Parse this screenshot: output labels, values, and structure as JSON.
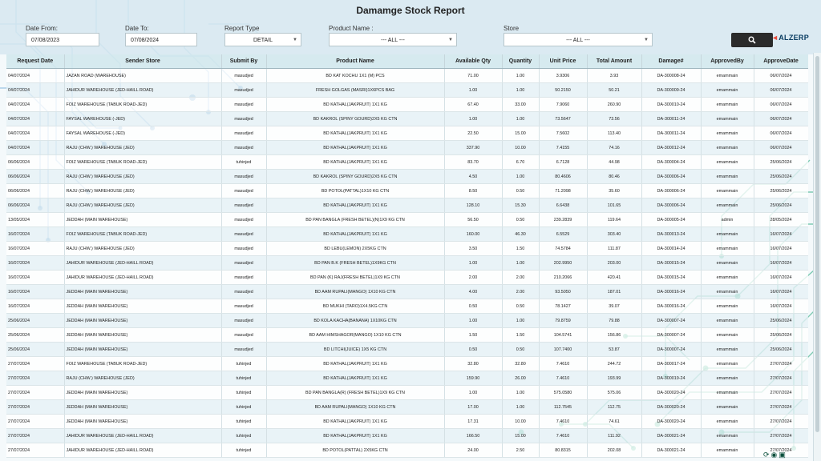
{
  "report": {
    "title": "Damamge Stock Report"
  },
  "filters": {
    "date_from_label": "Date From:",
    "date_from_value": "07/08/2023",
    "date_to_label": "Date To:",
    "date_to_value": "07/08/2024",
    "report_type_label": "Report Type",
    "report_type_value": "DETAIL",
    "product_label": "Product Name :",
    "product_value": "--- ALL ---",
    "store_label": "Store",
    "store_value": "--- ALL ---"
  },
  "logo": {
    "prefix": "◄",
    "text": "ALZERP"
  },
  "table": {
    "headers": [
      "Request Date",
      "Sender Store",
      "Submit By",
      "Product Name",
      "Available Qty",
      "Quantity",
      "Unit Price",
      "Total Amount",
      "Damage#",
      "ApprovedBy",
      "ApproveDate"
    ],
    "rows": [
      [
        "04/07/2024",
        "JAZAN ROAD (WAREHOUSE)",
        "masudjed",
        "BD KAT KOCHU 1X1 (M) PCS",
        "71.00",
        "1.00",
        "3.9306",
        "3.93",
        "DA-300008-24",
        "emammain",
        "06/07/2024"
      ],
      [
        "04/07/2024",
        "JAHIDUR WAREHOUSE (JED-HAILL ROAD)",
        "masudjed",
        "FRESH GOLGAS (MASRI)1X6PCS BAG",
        "1.00",
        "1.00",
        "50.2150",
        "50.21",
        "DA-300009-24",
        "emammain",
        "06/07/2024"
      ],
      [
        "04/07/2024",
        "FOIZ WAREHOUSE (TABUK ROAD-JED)",
        "masudjed",
        "BD KATHAL(JAKPRUIT) 1X1 KG",
        "67.40",
        "33.00",
        "7.9060",
        "260.90",
        "DA-300010-24",
        "emammain",
        "06/07/2024"
      ],
      [
        "04/07/2024",
        "FAYSAL WAREHOUSE (-JED)",
        "masudjed",
        "BD KAKROL (SPINY GOURD)2X5 KG CTN",
        "1.00",
        "1.00",
        "73.5647",
        "73.56",
        "DA-300011-24",
        "emammain",
        "06/07/2024"
      ],
      [
        "04/07/2024",
        "FAYSAL WAREHOUSE (-JED)",
        "masudjed",
        "BD KATHAL(JAKPRUIT) 1X1 KG",
        "22.50",
        "15.00",
        "7.5602",
        "113.40",
        "DA-300011-24",
        "emammain",
        "06/07/2024"
      ],
      [
        "04/07/2024",
        "RAJU (CHW.) WAREHOUSE (JED)",
        "masudjed",
        "BD KATHAL(JAKPRUIT) 1X1 KG",
        "337.90",
        "10.00",
        "7.4155",
        "74.16",
        "DA-300012-24",
        "emammain",
        "06/07/2024"
      ],
      [
        "06/06/2024",
        "FOIZ WAREHOUSE (TABUK ROAD-JED)",
        "tuhinjed",
        "BD KATHAL(JAKPRUIT) 1X1 KG",
        "83.70",
        "6.70",
        "6.7128",
        "44.98",
        "DA-300004-24",
        "emammain",
        "25/06/2024"
      ],
      [
        "06/06/2024",
        "RAJU (CHW.) WAREHOUSE (JED)",
        "masudjed",
        "BD KAKROL (SPINY GOURD)2X5 KG CTN",
        "4.50",
        "1.00",
        "80.4606",
        "80.46",
        "DA-300006-24",
        "emammain",
        "25/06/2024"
      ],
      [
        "06/06/2024",
        "RAJU (CHW.) WAREHOUSE (JED)",
        "masudjed",
        "BD POTOL(PATTAL)1X10 KG CTN",
        "8.50",
        "0.50",
        "71.2098",
        "35.60",
        "DA-300006-24",
        "emammain",
        "25/06/2024"
      ],
      [
        "06/06/2024",
        "RAJU (CHW.) WAREHOUSE (JED)",
        "masudjed",
        "BD KATHAL(JAKPRUIT) 1X1 KG",
        "128.10",
        "15.30",
        "6.6438",
        "101.65",
        "DA-300006-24",
        "emammain",
        "25/06/2024"
      ],
      [
        "13/05/2024",
        "JEDDAH (MAIN WAREHOUSE)",
        "masudjed",
        "BD PAN BANGLA (FRESH BETEL)(N)1X9 KG CTN",
        "56.50",
        "0.50",
        "239.2839",
        "119.64",
        "DA-300005-24",
        "admin",
        "28/05/2024"
      ],
      [
        "16/07/2024",
        "FOIZ WAREHOUSE (TABUK ROAD-JED)",
        "masudjed",
        "BD KATHAL(JAKPRUIT) 1X1 KG",
        "160.00",
        "46.30",
        "6.5529",
        "303.40",
        "DA-300013-24",
        "emammain",
        "16/07/2024"
      ],
      [
        "16/07/2024",
        "RAJU (CHW.) WAREHOUSE (JED)",
        "masudjed",
        "BD LEBU(LEMON) 2X5KG CTN",
        "3.50",
        "1.50",
        "74.5784",
        "111.87",
        "DA-300014-24",
        "emammain",
        "16/07/2024"
      ],
      [
        "16/07/2024",
        "JAHIDUR WAREHOUSE (JED-HAILL ROAD)",
        "masudjed",
        "BD PAN B.K (FRESH BETEL)1X9KG CTN",
        "1.00",
        "1.00",
        "202.9950",
        "203.00",
        "DA-300015-24",
        "emammain",
        "16/07/2024"
      ],
      [
        "16/07/2024",
        "JAHIDUR WAREHOUSE (JED-HAILL ROAD)",
        "masudjed",
        "BD PAN (K) RAJ(FRESH BETEL)1X9 KG CTN",
        "2.00",
        "2.00",
        "210.2066",
        "420.41",
        "DA-300015-24",
        "emammain",
        "16/07/2024"
      ],
      [
        "16/07/2024",
        "JEDDAH (MAIN WAREHOUSE)",
        "masudjed",
        "BD AAM RUPALI(MANGO) 1X10 KG CTN",
        "4.00",
        "2.00",
        "93.5050",
        "187.01",
        "DA-300016-24",
        "emammain",
        "16/07/2024"
      ],
      [
        "16/07/2024",
        "JEDDAH (MAIN WAREHOUSE)",
        "masudjed",
        "BD MUKHI (TARO)1X4.5KG CTN",
        "0.50",
        "0.50",
        "78.1427",
        "39.07",
        "DA-300016-24",
        "emammain",
        "16/07/2024"
      ],
      [
        "25/06/2024",
        "JEDDAH (MAIN WAREHOUSE)",
        "masudjed",
        "BD KOLA KACHA(BANANA) 1X10KG CTN",
        "1.00",
        "1.00",
        "79.8759",
        "79.88",
        "DA-300007-24",
        "emammain",
        "25/06/2024"
      ],
      [
        "25/06/2024",
        "JEDDAH (MAIN WAREHOUSE)",
        "masudjed",
        "BD AAM HIMSHAGOR(MANGO) 1X10 KG CTN",
        "1.50",
        "1.50",
        "104.5741",
        "156.86",
        "DA-300007-24",
        "emammain",
        "25/06/2024"
      ],
      [
        "25/06/2024",
        "JEDDAH (MAIN WAREHOUSE)",
        "masudjed",
        "BD LITCHI(JUICE) 1X5 KG CTN",
        "0.50",
        "0.50",
        "107.7400",
        "53.87",
        "DA-300007-24",
        "emammain",
        "25/06/2024"
      ],
      [
        "27/07/2024",
        "FOIZ WAREHOUSE (TABUK ROAD-JED)",
        "tuhinjed",
        "BD KATHAL(JAKPRUIT) 1X1 KG",
        "32.80",
        "32.80",
        "7.4610",
        "244.72",
        "DA-300017-24",
        "emammain",
        "27/07/2024"
      ],
      [
        "27/07/2024",
        "RAJU (CHW.) WAREHOUSE (JED)",
        "tuhinjed",
        "BD KATHAL(JAKPRUIT) 1X1 KG",
        "159.90",
        "26.00",
        "7.4610",
        "193.99",
        "DA-300019-24",
        "emammain",
        "27/07/2024"
      ],
      [
        "27/07/2024",
        "JEDDAH (MAIN WAREHOUSE)",
        "tuhinjed",
        "BD PAN BANGLA(R) (FRESH BETEL)1X9 KG CTN",
        "1.00",
        "1.00",
        "575.0580",
        "575.06",
        "DA-300020-24",
        "emammain",
        "27/07/2024"
      ],
      [
        "27/07/2024",
        "JEDDAH (MAIN WAREHOUSE)",
        "tuhinjed",
        "BD AAM RUPALI(MANGO) 1X10 KG CTN",
        "17.00",
        "1.00",
        "112.7545",
        "112.75",
        "DA-300020-24",
        "emammain",
        "27/07/2024"
      ],
      [
        "27/07/2024",
        "JEDDAH (MAIN WAREHOUSE)",
        "tuhinjed",
        "BD KATHAL(JAKPRUIT) 1X1 KG",
        "17.31",
        "10.00",
        "7.4610",
        "74.61",
        "DA-300020-24",
        "emammain",
        "27/07/2024"
      ],
      [
        "27/07/2024",
        "JAHIDUR WAREHOUSE (JED-HAILL ROAD)",
        "tuhinjed",
        "BD KATHAL(JAKPRUIT) 1X1 KG",
        "166.50",
        "15.00",
        "7.4610",
        "111.92",
        "DA-300021-24",
        "emammain",
        "27/07/2024"
      ],
      [
        "27/07/2024",
        "JAHIDUR WAREHOUSE (JED-HAILL ROAD)",
        "tuhinjed",
        "BD POTOL(PATTAL) 2X5KG CTN",
        "24.00",
        "2.50",
        "80.8315",
        "202.08",
        "DA-300021-24",
        "emammain",
        "27/07/2024"
      ]
    ]
  },
  "colors": {
    "accent": "#2b2b2b",
    "header_bg": "#d6e8f0",
    "circuit_blue": "#4a90c8",
    "circuit_green": "#1fa57a"
  }
}
